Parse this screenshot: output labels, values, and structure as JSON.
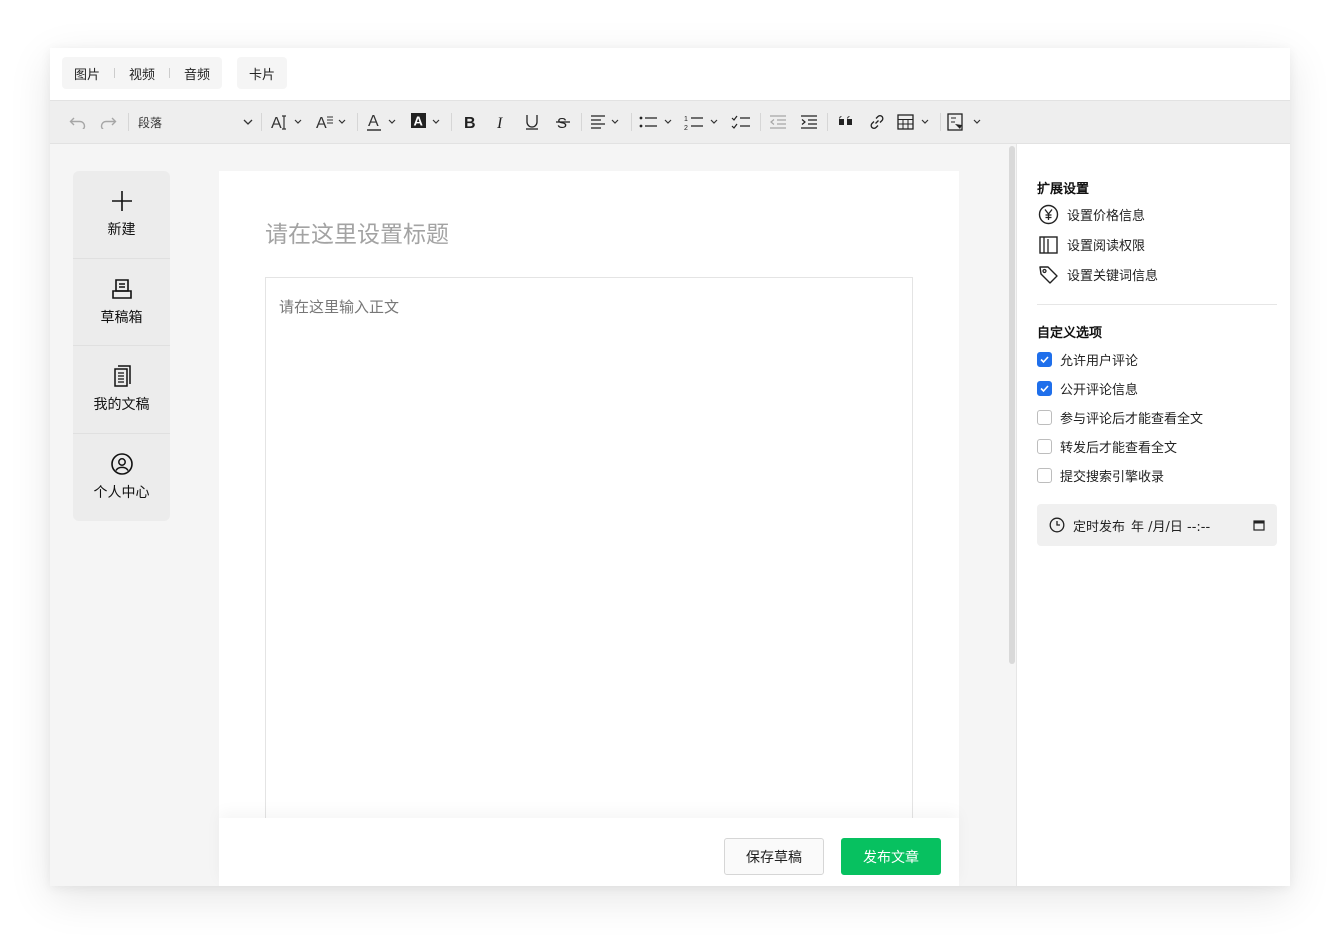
{
  "insert_bar": {
    "group1": [
      "图片",
      "视频",
      "音频"
    ],
    "group2": [
      "卡片"
    ]
  },
  "toolbar": {
    "paragraph_style": "段落",
    "buttons": [
      "undo-icon",
      "redo-icon",
      "font-size-icon",
      "line-height-icon",
      "font-color-icon",
      "background-color-icon",
      "bold-icon",
      "italic-icon",
      "underline-icon",
      "strikethrough-icon",
      "align-icon",
      "bullet-list-icon",
      "numbered-list-icon",
      "checklist-icon",
      "outdent-icon",
      "indent-icon",
      "quote-icon",
      "link-icon",
      "table-icon",
      "template-icon"
    ]
  },
  "left_nav": {
    "items": [
      {
        "label": "新建",
        "icon": "plus-icon"
      },
      {
        "label": "草稿箱",
        "icon": "drafts-icon"
      },
      {
        "label": "我的文稿",
        "icon": "documents-icon"
      },
      {
        "label": "个人中心",
        "icon": "user-icon"
      }
    ]
  },
  "editor": {
    "title_placeholder": "请在这里设置标题",
    "body_placeholder": "请在这里输入正文"
  },
  "footer": {
    "save_draft": "保存草稿",
    "publish": "发布文章"
  },
  "right_panel": {
    "ext_title": "扩展设置",
    "ext_items": [
      {
        "label": "设置价格信息",
        "icon": "yen-icon"
      },
      {
        "label": "设置阅读权限",
        "icon": "book-icon"
      },
      {
        "label": "设置关键词信息",
        "icon": "tag-icon"
      }
    ],
    "custom_title": "自定义选项",
    "options": [
      {
        "label": "允许用户评论",
        "checked": true
      },
      {
        "label": "公开评论信息",
        "checked": true
      },
      {
        "label": "参与评论后才能查看全文",
        "checked": false
      },
      {
        "label": "转发后才能查看全文",
        "checked": false
      },
      {
        "label": "提交搜索引擎收录",
        "checked": false
      }
    ],
    "schedule_label": "定时发布",
    "schedule_value": "年 /月/日 --:--"
  },
  "colors": {
    "accent_green": "#07c160",
    "checkbox_blue": "#1f6feb"
  }
}
